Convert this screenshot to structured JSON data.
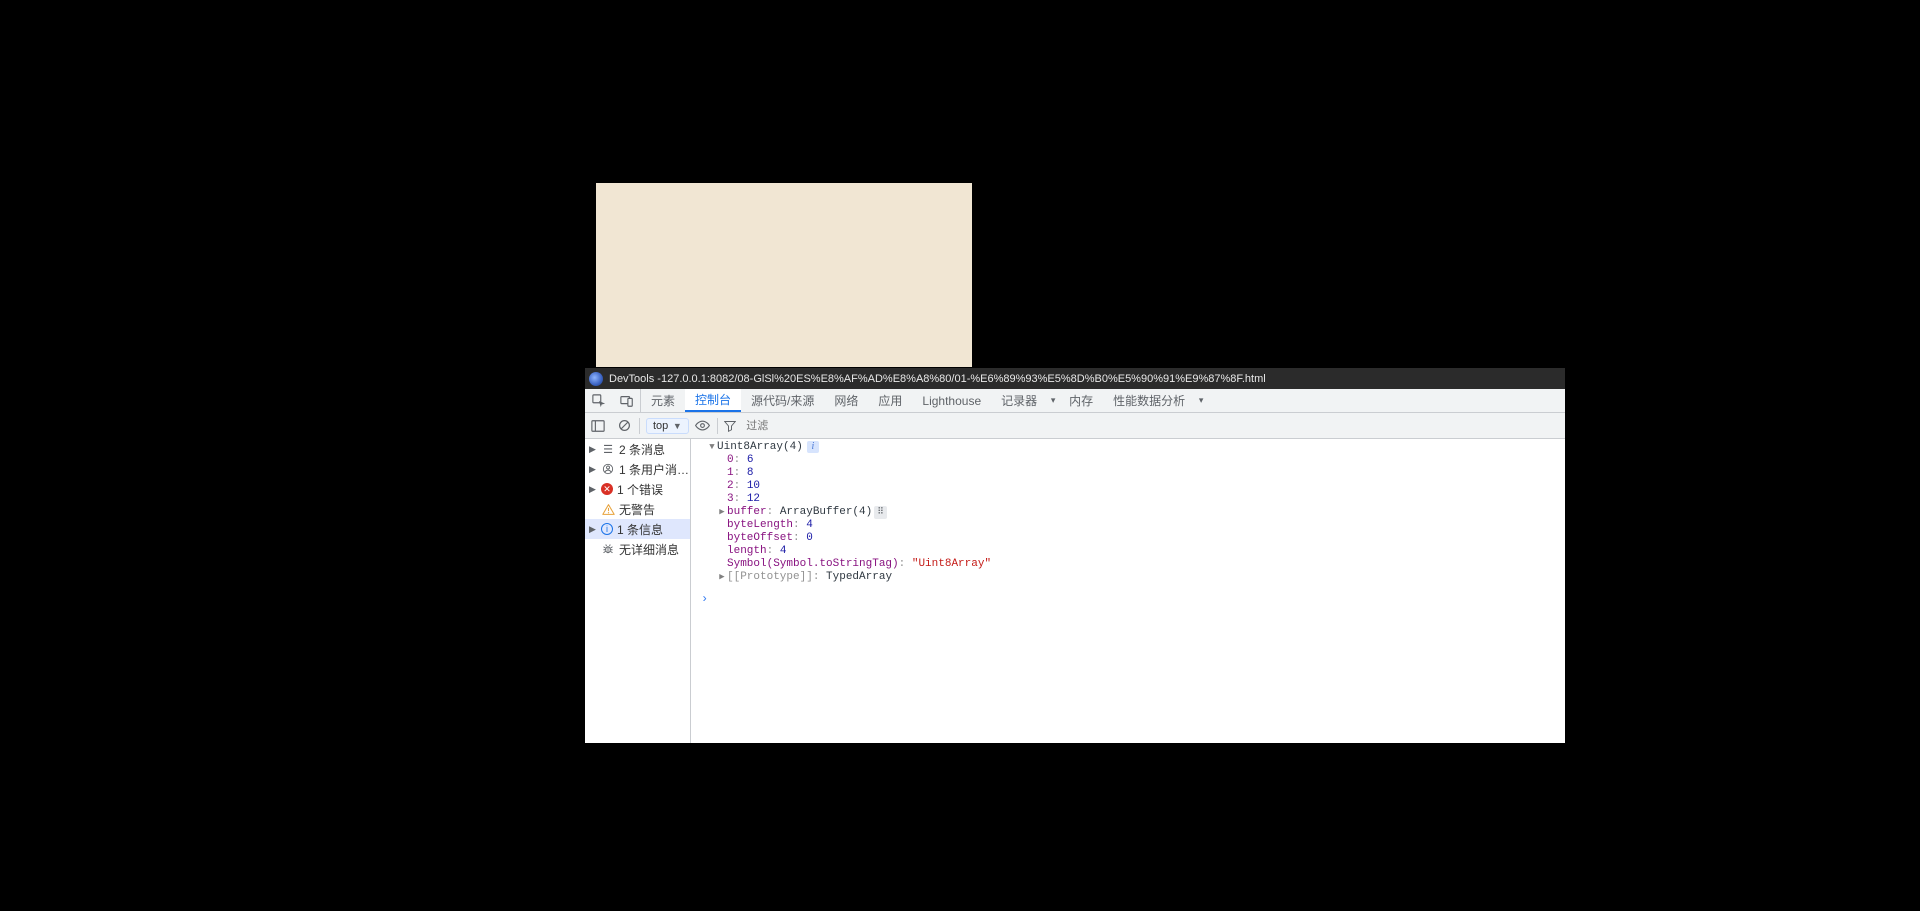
{
  "titlebar": {
    "prefix": "DevTools - ",
    "url": "127.0.0.1:8082/08-GlSl%20ES%E8%AF%AD%E8%A8%80/01-%E6%89%93%E5%8D%B0%E5%90%91%E9%87%8F.html"
  },
  "tabs": {
    "elements": "元素",
    "console": "控制台",
    "sources": "源代码/来源",
    "network": "网络",
    "application": "应用",
    "lighthouse": "Lighthouse",
    "recorder": "记录器",
    "memory": "内存",
    "performance": "性能数据分析"
  },
  "toolbar": {
    "context": "top",
    "filter_placeholder": "过滤"
  },
  "sidebar": {
    "messages": "2 条消息",
    "user": "1 条用户消…",
    "errors": "1 个错误",
    "warnings": "无警告",
    "info": "1 条信息",
    "verbose": "无详细消息"
  },
  "console": {
    "header_type": "Uint8Array(4)",
    "items": [
      {
        "index": "0",
        "value": "6"
      },
      {
        "index": "1",
        "value": "8"
      },
      {
        "index": "2",
        "value": "10"
      },
      {
        "index": "3",
        "value": "12"
      }
    ],
    "buffer_key": "buffer",
    "buffer_value": "ArrayBuffer(4)",
    "byteLength_key": "byteLength",
    "byteLength_value": "4",
    "byteOffset_key": "byteOffset",
    "byteOffset_value": "0",
    "length_key": "length",
    "length_value": "4",
    "symbol_key": "Symbol(Symbol.toStringTag)",
    "symbol_value": "\"Uint8Array\"",
    "proto_key": "[[Prototype]]",
    "proto_value": "TypedArray"
  }
}
